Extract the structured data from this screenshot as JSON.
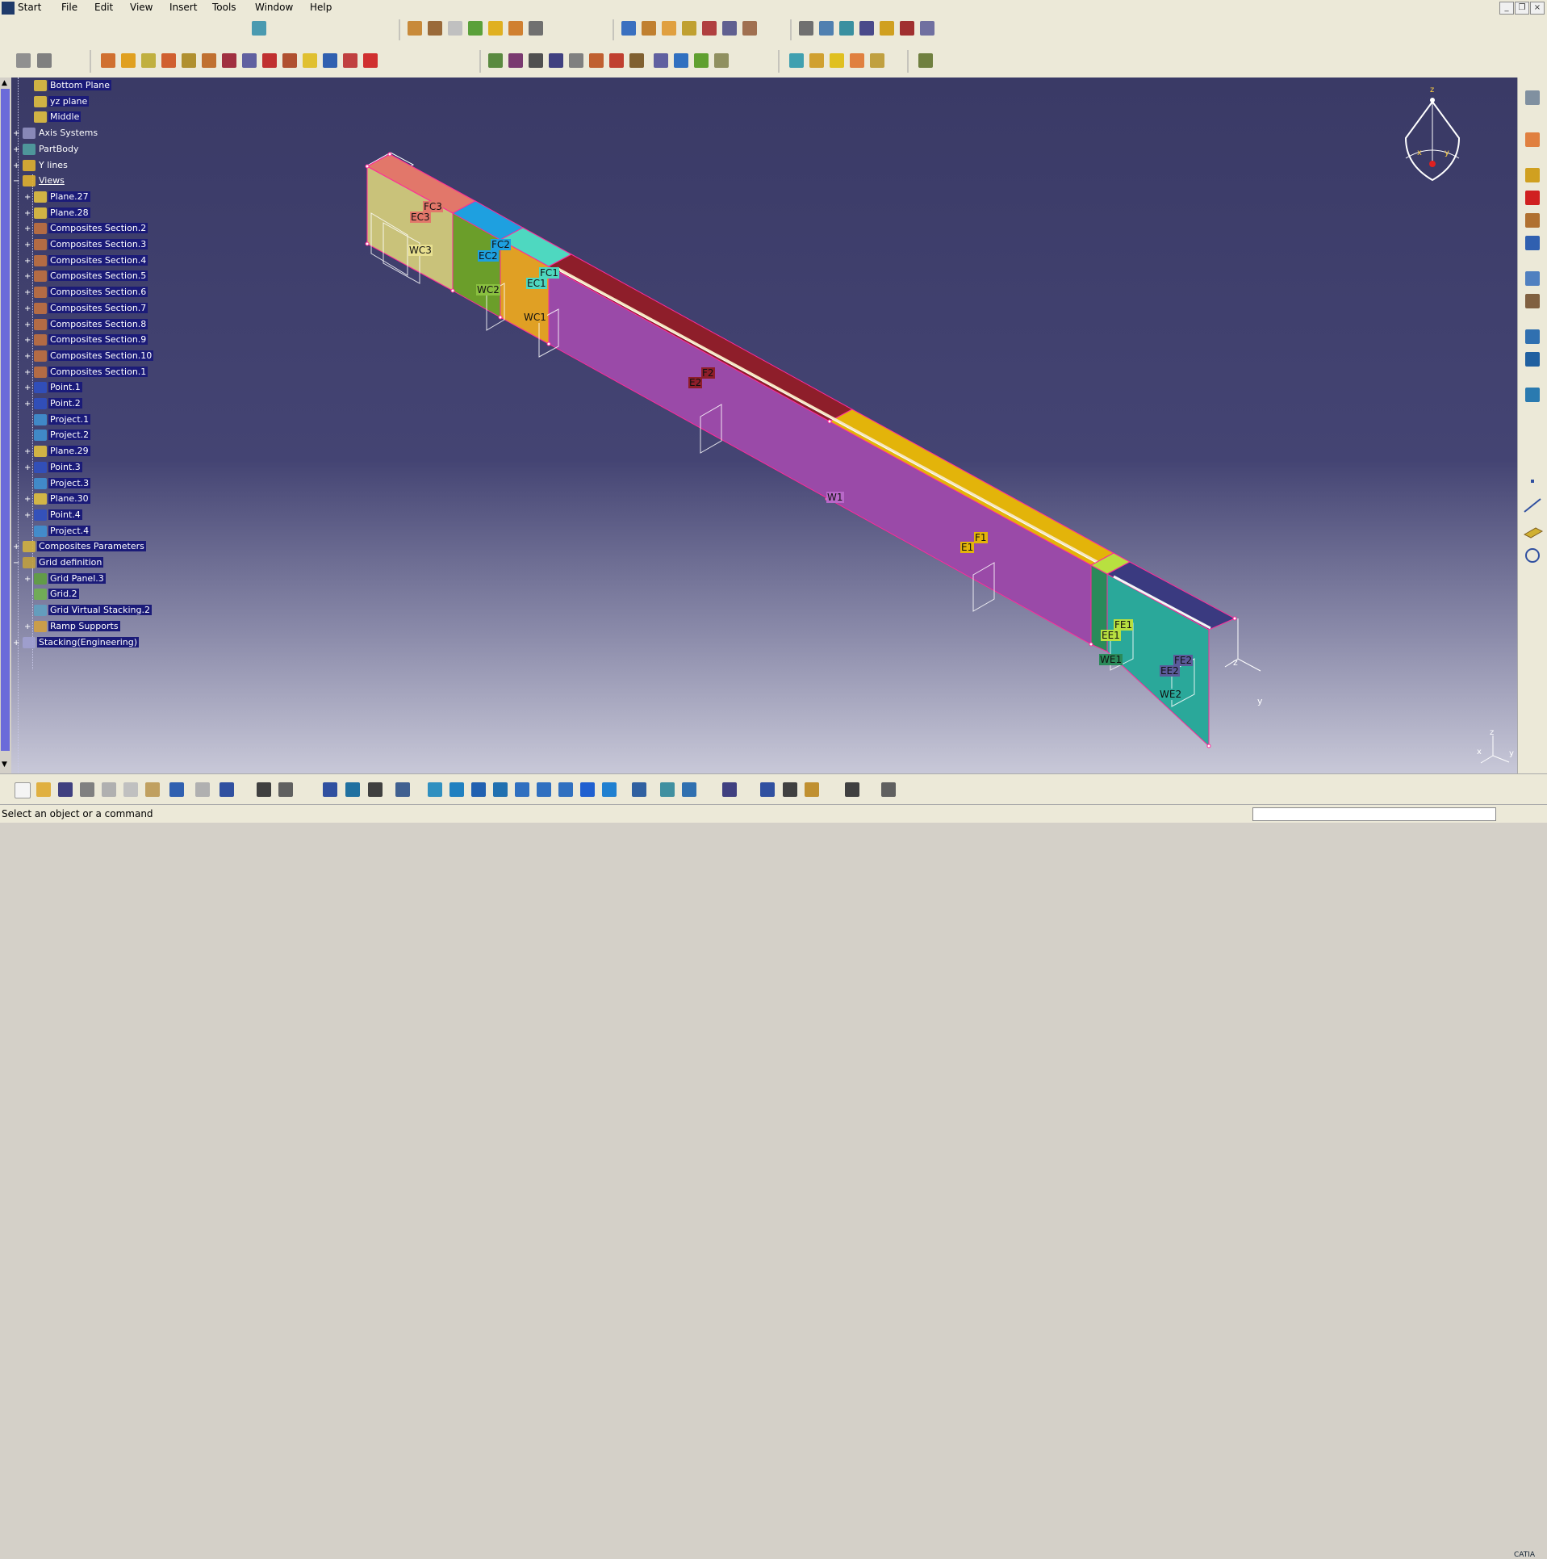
{
  "menubar": {
    "items": [
      "Start",
      "File",
      "Edit",
      "View",
      "Insert",
      "Tools",
      "Window",
      "Help"
    ]
  },
  "window_controls": {
    "minimize": "_",
    "restore": "❐",
    "close": "×"
  },
  "tree": {
    "items": [
      {
        "label": "Bottom Plane",
        "icon": "plane-icon",
        "level": 1,
        "expander": ""
      },
      {
        "label": "yz plane",
        "icon": "plane-icon",
        "level": 1,
        "expander": ""
      },
      {
        "label": "Middle",
        "icon": "plane-icon",
        "level": 1,
        "expander": ""
      },
      {
        "label": "Axis Systems",
        "icon": "axis-system-icon",
        "level": 0,
        "expander": "+"
      },
      {
        "label": "PartBody",
        "icon": "gear-icon",
        "level": 0,
        "expander": "+"
      },
      {
        "label": "Y lines",
        "icon": "geometrical-set-icon",
        "level": 0,
        "expander": "+"
      },
      {
        "label": "Views",
        "icon": "geometrical-set-icon",
        "level": 0,
        "expander": "−"
      },
      {
        "label": "Plane.27",
        "icon": "plane-icon",
        "level": 1,
        "expander": "+"
      },
      {
        "label": "Plane.28",
        "icon": "plane-icon",
        "level": 1,
        "expander": "+"
      },
      {
        "label": "Composites Section.2",
        "icon": "composites-section-icon",
        "level": 1,
        "expander": "+"
      },
      {
        "label": "Composites Section.3",
        "icon": "composites-section-icon",
        "level": 1,
        "expander": "+"
      },
      {
        "label": "Composites Section.4",
        "icon": "composites-section-icon",
        "level": 1,
        "expander": "+"
      },
      {
        "label": "Composites Section.5",
        "icon": "composites-section-icon",
        "level": 1,
        "expander": "+"
      },
      {
        "label": "Composites Section.6",
        "icon": "composites-section-icon",
        "level": 1,
        "expander": "+"
      },
      {
        "label": "Composites Section.7",
        "icon": "composites-section-icon",
        "level": 1,
        "expander": "+"
      },
      {
        "label": "Composites Section.8",
        "icon": "composites-section-icon",
        "level": 1,
        "expander": "+"
      },
      {
        "label": "Composites Section.9",
        "icon": "composites-section-icon",
        "level": 1,
        "expander": "+"
      },
      {
        "label": "Composites Section.10",
        "icon": "composites-section-icon",
        "level": 1,
        "expander": "+"
      },
      {
        "label": "Composites Section.1",
        "icon": "composites-section-icon",
        "level": 1,
        "expander": "+"
      },
      {
        "label": "Point.1",
        "icon": "point-icon",
        "level": 1,
        "expander": "+"
      },
      {
        "label": "Point.2",
        "icon": "point-icon",
        "level": 1,
        "expander": "+"
      },
      {
        "label": "Project.1",
        "icon": "projection-icon",
        "level": 1,
        "expander": ""
      },
      {
        "label": "Project.2",
        "icon": "projection-icon",
        "level": 1,
        "expander": ""
      },
      {
        "label": "Plane.29",
        "icon": "plane-icon",
        "level": 1,
        "expander": "+"
      },
      {
        "label": "Point.3",
        "icon": "point-icon",
        "level": 1,
        "expander": "+"
      },
      {
        "label": "Project.3",
        "icon": "projection-icon",
        "level": 1,
        "expander": ""
      },
      {
        "label": "Plane.30",
        "icon": "plane-icon",
        "level": 1,
        "expander": "+"
      },
      {
        "label": "Point.4",
        "icon": "point-icon",
        "level": 1,
        "expander": "+"
      },
      {
        "label": "Project.4",
        "icon": "projection-icon",
        "level": 1,
        "expander": ""
      },
      {
        "label": "Composites Parameters",
        "icon": "composites-parameters-icon",
        "level": 0,
        "expander": "+"
      },
      {
        "label": "Grid definition",
        "icon": "grid-definition-icon",
        "level": 0,
        "expander": "−"
      },
      {
        "label": "Grid Panel.3",
        "icon": "grid-panel-icon",
        "level": 1,
        "expander": "+"
      },
      {
        "label": "Grid.2",
        "icon": "grid-icon",
        "level": 1,
        "expander": ""
      },
      {
        "label": "Grid Virtual Stacking.2",
        "icon": "virtual-stacking-icon",
        "level": 1,
        "expander": ""
      },
      {
        "label": "Ramp Supports",
        "icon": "ramp-supports-icon",
        "level": 1,
        "expander": "+"
      },
      {
        "label": "Stacking(Engineering)",
        "icon": "stacking-icon",
        "level": 0,
        "expander": "+"
      }
    ]
  },
  "model_labels": {
    "fc3": "FC3",
    "ec3": "EC3",
    "wc3": "WC3",
    "fc2": "FC2",
    "ec2": "EC2",
    "wc2": "WC2",
    "fc1": "FC1",
    "ec1": "EC1",
    "wc1": "WC1",
    "f2": "F2",
    "e2": "E2",
    "w1": "W1",
    "f1": "F1",
    "e1": "E1",
    "fe1": "FE1",
    "ee1": "EE1",
    "we1": "WE1",
    "fe2": "FE2",
    "ee2": "EE2",
    "we2": "WE2"
  },
  "colors": {
    "viewport_top": "#3a3a66",
    "web_purple": "#9a4aa8",
    "flange_dark_red": "#8e1e2a",
    "flange_yellow": "#e3b40a",
    "salmon": "#e2776a",
    "wc3": "#c9c27a",
    "wc2": "#6b9e2a",
    "wc1": "#e0a024",
    "fc2": "#1ea0e0",
    "fc1": "#4ed8c0",
    "teal": "#2aa89a",
    "edge_pink": "#ff2a9a",
    "selection": "#1b1b78"
  },
  "compass_axes": {
    "x": "x",
    "y": "y",
    "z": "z"
  },
  "status": {
    "message": "Select an object or a command"
  },
  "brand": {
    "logo_text": "CATIA"
  }
}
